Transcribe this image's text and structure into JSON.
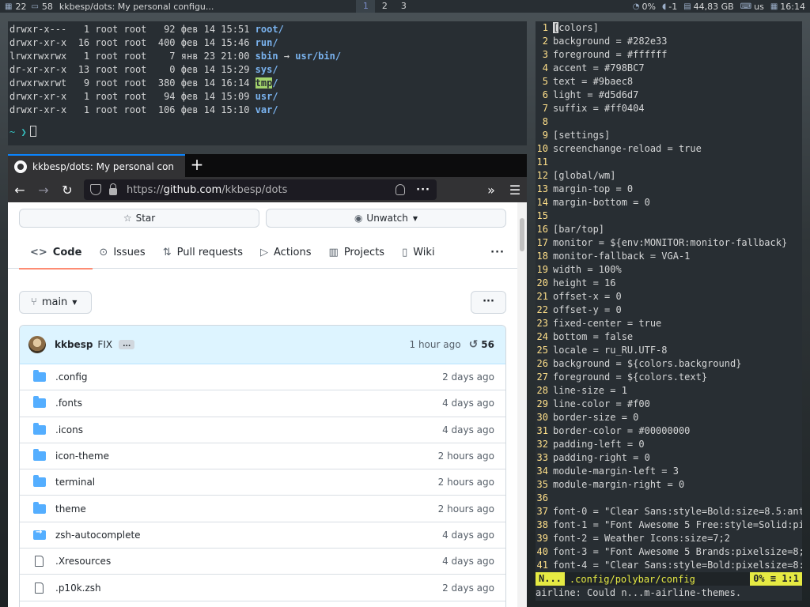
{
  "topbar": {
    "window_count": "22",
    "window_id": "58",
    "window_title": "kkbesp/dots: My personal configu...",
    "workspaces": [
      "1",
      "2",
      "3"
    ],
    "active_workspace": "1",
    "wifi": "0%",
    "volume": "-1",
    "disk": "44,83 GB",
    "layout": "us",
    "time": "16:14"
  },
  "terminal": {
    "rows": [
      {
        "meta": "drwxr-x---   1 root root   92 фев 14 15:51 ",
        "name": "root",
        "suffix": "/",
        "link": "",
        "hl": false
      },
      {
        "meta": "drwxr-xr-x  16 root root  400 фев 14 15:46 ",
        "name": "run",
        "suffix": "/",
        "link": "",
        "hl": false
      },
      {
        "meta": "lrwxrwxrwx   1 root root    7 янв 23 21:00 ",
        "name": "sbin",
        "suffix": " → ",
        "link": "usr/bin/",
        "hl": false
      },
      {
        "meta": "dr-xr-xr-x  13 root root    0 фев 14 15:29 ",
        "name": "sys",
        "suffix": "/",
        "link": "",
        "hl": false
      },
      {
        "meta": "drwxrwxrwt   9 root root  380 фев 14 16:14 ",
        "name": "tmp",
        "suffix": "/",
        "link": "",
        "hl": true
      },
      {
        "meta": "drwxr-xr-x   1 root root   94 фев 14 15:09 ",
        "name": "usr",
        "suffix": "/",
        "link": "",
        "hl": false
      },
      {
        "meta": "drwxr-xr-x   1 root root  106 фев 14 15:10 ",
        "name": "var",
        "suffix": "/",
        "link": "",
        "hl": false
      }
    ],
    "prompt": "~ ❯"
  },
  "browser": {
    "tab_title": "kkbesp/dots: My personal con",
    "new_tab": "+",
    "url_scheme": "https://",
    "url_host": "github.com",
    "url_path": "/kkbesp/dots",
    "star_label": "Star",
    "unwatch_label": "Unwatch",
    "nav": [
      {
        "label": "Code",
        "icon": "code-icon"
      },
      {
        "label": "Issues",
        "icon": "issue-icon"
      },
      {
        "label": "Pull requests",
        "icon": "pull-request-icon"
      },
      {
        "label": "Actions",
        "icon": "play-icon"
      },
      {
        "label": "Projects",
        "icon": "project-icon"
      },
      {
        "label": "Wiki",
        "icon": "book-icon"
      }
    ],
    "more": "···",
    "branch": "main",
    "commit": {
      "author": "kkbesp",
      "message": "FIX",
      "ellipsis": "...",
      "time": "1 hour ago",
      "count": "56"
    },
    "files": [
      {
        "name": ".config",
        "age": "2 days ago",
        "type": "dir"
      },
      {
        "name": ".fonts",
        "age": "4 days ago",
        "type": "dir"
      },
      {
        "name": ".icons",
        "age": "4 days ago",
        "type": "dir"
      },
      {
        "name": "icon-theme",
        "age": "2 hours ago",
        "type": "dir"
      },
      {
        "name": "terminal",
        "age": "2 hours ago",
        "type": "dir"
      },
      {
        "name": "theme",
        "age": "2 hours ago",
        "type": "dir"
      },
      {
        "name": "zsh-autocomplete",
        "age": "4 days ago",
        "type": "sub"
      },
      {
        "name": ".Xresources",
        "age": "4 days ago",
        "type": "file"
      },
      {
        "name": ".p10k.zsh",
        "age": "2 days ago",
        "type": "file"
      }
    ]
  },
  "vim": {
    "lines": [
      "[colors]",
      "background = #282e33",
      "foreground = #ffffff",
      "accent = #798BC7",
      "text = #9baec8",
      "light = #d5d6d7",
      "suffix = #ff0404",
      "",
      "[settings]",
      "screenchange-reload = true",
      "",
      "[global/wm]",
      "margin-top = 0",
      "margin-bottom = 0",
      "",
      "[bar/top]",
      "monitor = ${env:MONITOR:monitor-fallback}",
      "monitor-fallback = VGA-1",
      "width = 100%",
      "height = 16",
      "offset-x = 0",
      "offset-y = 0",
      "fixed-center = true",
      "bottom = false",
      "locale = ru_RU.UTF-8",
      "background = ${colors.background}",
      "foreground = ${colors.text}",
      "line-size = 1",
      "line-color = #f00",
      "border-size = 0",
      "border-color = #00000000",
      "padding-left = 0",
      "padding-right = 0",
      "module-margin-left = 3",
      "module-margin-right = 0",
      "",
      "font-0 = \"Clear Sans:style=Bold:size=8.5:ant",
      "font-1 = \"Font Awesome 5 Free:style=Solid:pi",
      "font-2 = Weather Icons:size=7;2",
      "font-3 = \"Font Awesome 5 Brands:pixelsize=8;",
      "font-4 = \"Clear Sans:style=Bold:pixelsize=8:"
    ],
    "mode": "N...",
    "file": ".config/polybar/config",
    "position": "0% ≡ 1:1",
    "message": "airline: Could n...m-airline-themes."
  }
}
